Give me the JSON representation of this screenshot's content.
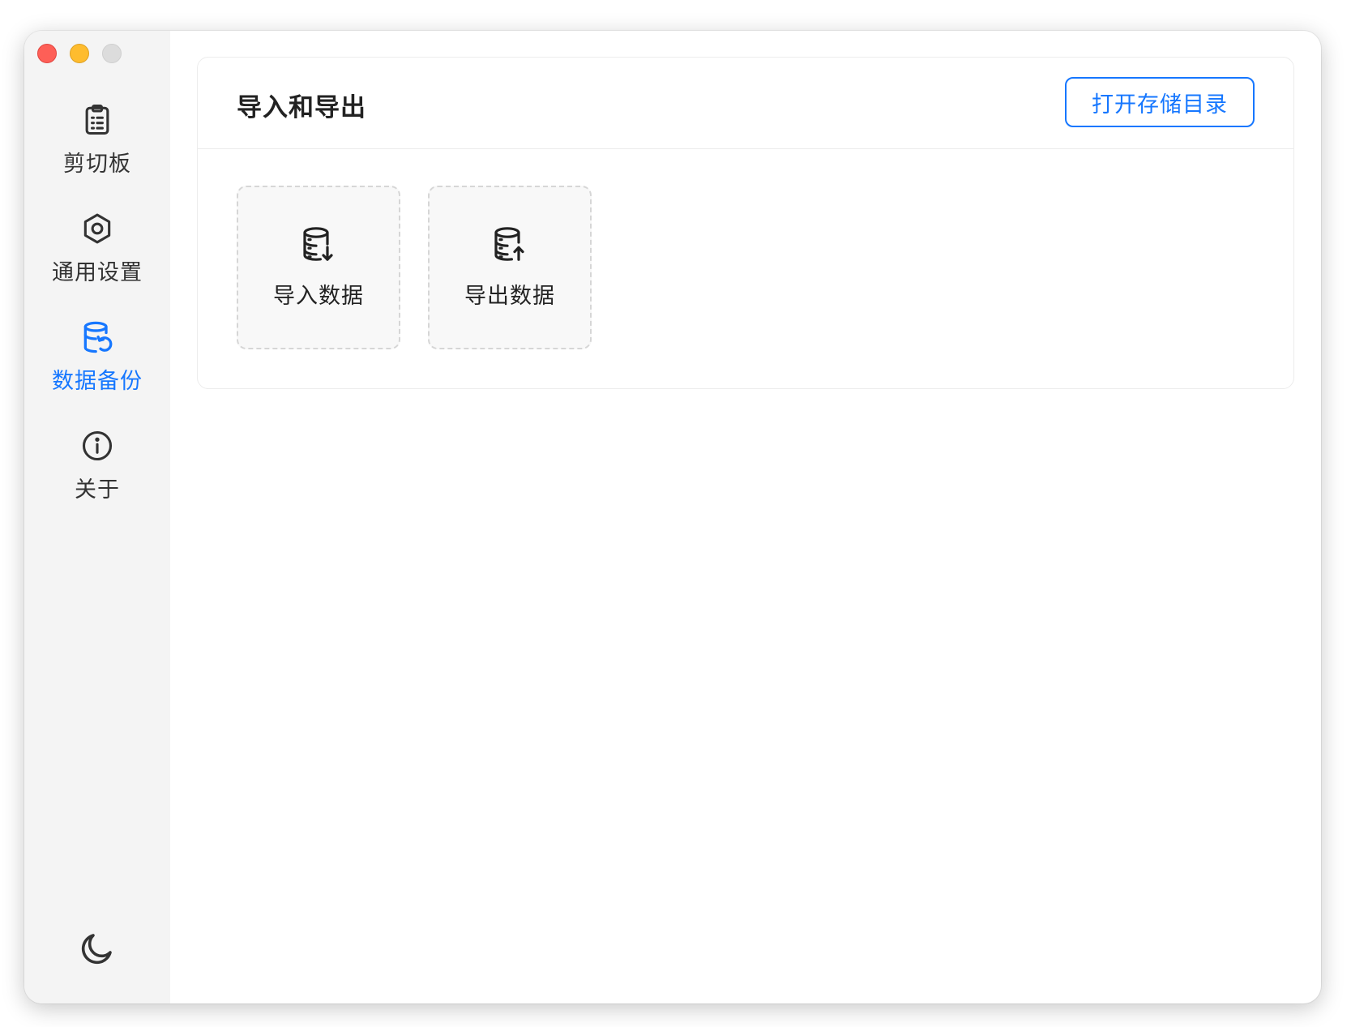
{
  "colors": {
    "accent": "#1677ff",
    "sidebar_bg": "#f4f4f4",
    "text": "#333333"
  },
  "window_controls": [
    "close",
    "minimize",
    "zoom"
  ],
  "sidebar": {
    "items": [
      {
        "icon": "clipboard-icon",
        "label": "剪切板",
        "active": false
      },
      {
        "icon": "settings-hexagon-icon",
        "label": "通用设置",
        "active": false
      },
      {
        "icon": "database-restore-icon",
        "label": "数据备份",
        "active": true
      },
      {
        "icon": "info-circle-icon",
        "label": "关于",
        "active": false
      }
    ],
    "theme_toggle_icon": "moon-icon"
  },
  "main": {
    "section_title": "导入和导出",
    "open_dir_button": "打开存储目录",
    "tiles": [
      {
        "icon": "database-import-icon",
        "label": "导入数据"
      },
      {
        "icon": "database-export-icon",
        "label": "导出数据"
      }
    ]
  }
}
